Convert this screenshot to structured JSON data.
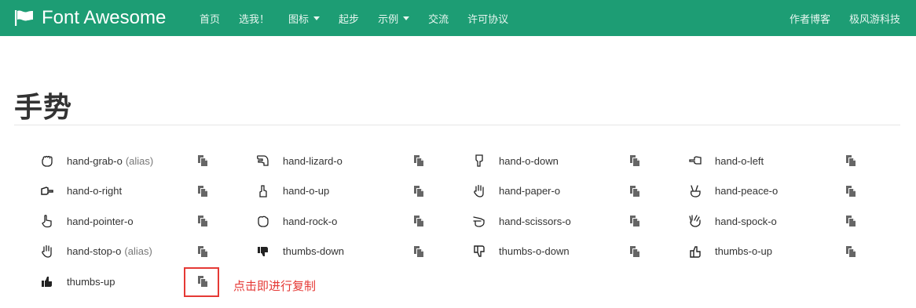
{
  "navbar": {
    "brand": "Font Awesome",
    "brand_icon": "flag-icon",
    "items": [
      {
        "label": "首页",
        "dropdown": false
      },
      {
        "label": "选我！",
        "dropdown": false
      },
      {
        "label": "图标",
        "dropdown": true
      },
      {
        "label": "起步",
        "dropdown": false
      },
      {
        "label": "示例",
        "dropdown": true
      },
      {
        "label": "交流",
        "dropdown": false
      },
      {
        "label": "许可协议",
        "dropdown": false
      }
    ],
    "right_items": [
      {
        "label": "作者博客"
      },
      {
        "label": "极风游科技"
      }
    ],
    "colors": {
      "background": "#1d9d74",
      "text": "#ffffff"
    }
  },
  "page": {
    "title": "手势"
  },
  "icons": [
    [
      {
        "name": "hand-grab-o",
        "alias": "(alias)",
        "icon": "hand-grab-o-icon"
      },
      {
        "name": "hand-lizard-o",
        "alias": "",
        "icon": "hand-lizard-o-icon"
      },
      {
        "name": "hand-o-down",
        "alias": "",
        "icon": "hand-o-down-icon"
      },
      {
        "name": "hand-o-left",
        "alias": "",
        "icon": "hand-o-left-icon"
      }
    ],
    [
      {
        "name": "hand-o-right",
        "alias": "",
        "icon": "hand-o-right-icon"
      },
      {
        "name": "hand-o-up",
        "alias": "",
        "icon": "hand-o-up-icon"
      },
      {
        "name": "hand-paper-o",
        "alias": "",
        "icon": "hand-paper-o-icon"
      },
      {
        "name": "hand-peace-o",
        "alias": "",
        "icon": "hand-peace-o-icon"
      }
    ],
    [
      {
        "name": "hand-pointer-o",
        "alias": "",
        "icon": "hand-pointer-o-icon"
      },
      {
        "name": "hand-rock-o",
        "alias": "",
        "icon": "hand-rock-o-icon"
      },
      {
        "name": "hand-scissors-o",
        "alias": "",
        "icon": "hand-scissors-o-icon"
      },
      {
        "name": "hand-spock-o",
        "alias": "",
        "icon": "hand-spock-o-icon"
      }
    ],
    [
      {
        "name": "hand-stop-o",
        "alias": "(alias)",
        "icon": "hand-stop-o-icon"
      },
      {
        "name": "thumbs-down",
        "alias": "",
        "icon": "thumbs-down-icon"
      },
      {
        "name": "thumbs-o-down",
        "alias": "",
        "icon": "thumbs-o-down-icon"
      },
      {
        "name": "thumbs-o-up",
        "alias": "",
        "icon": "thumbs-o-up-icon"
      }
    ],
    [
      {
        "name": "thumbs-up",
        "alias": "",
        "icon": "thumbs-up-icon"
      }
    ]
  ],
  "copy_icon": "copy-icon",
  "annotation": {
    "text": "点击即进行复制",
    "color": "#e53935"
  }
}
